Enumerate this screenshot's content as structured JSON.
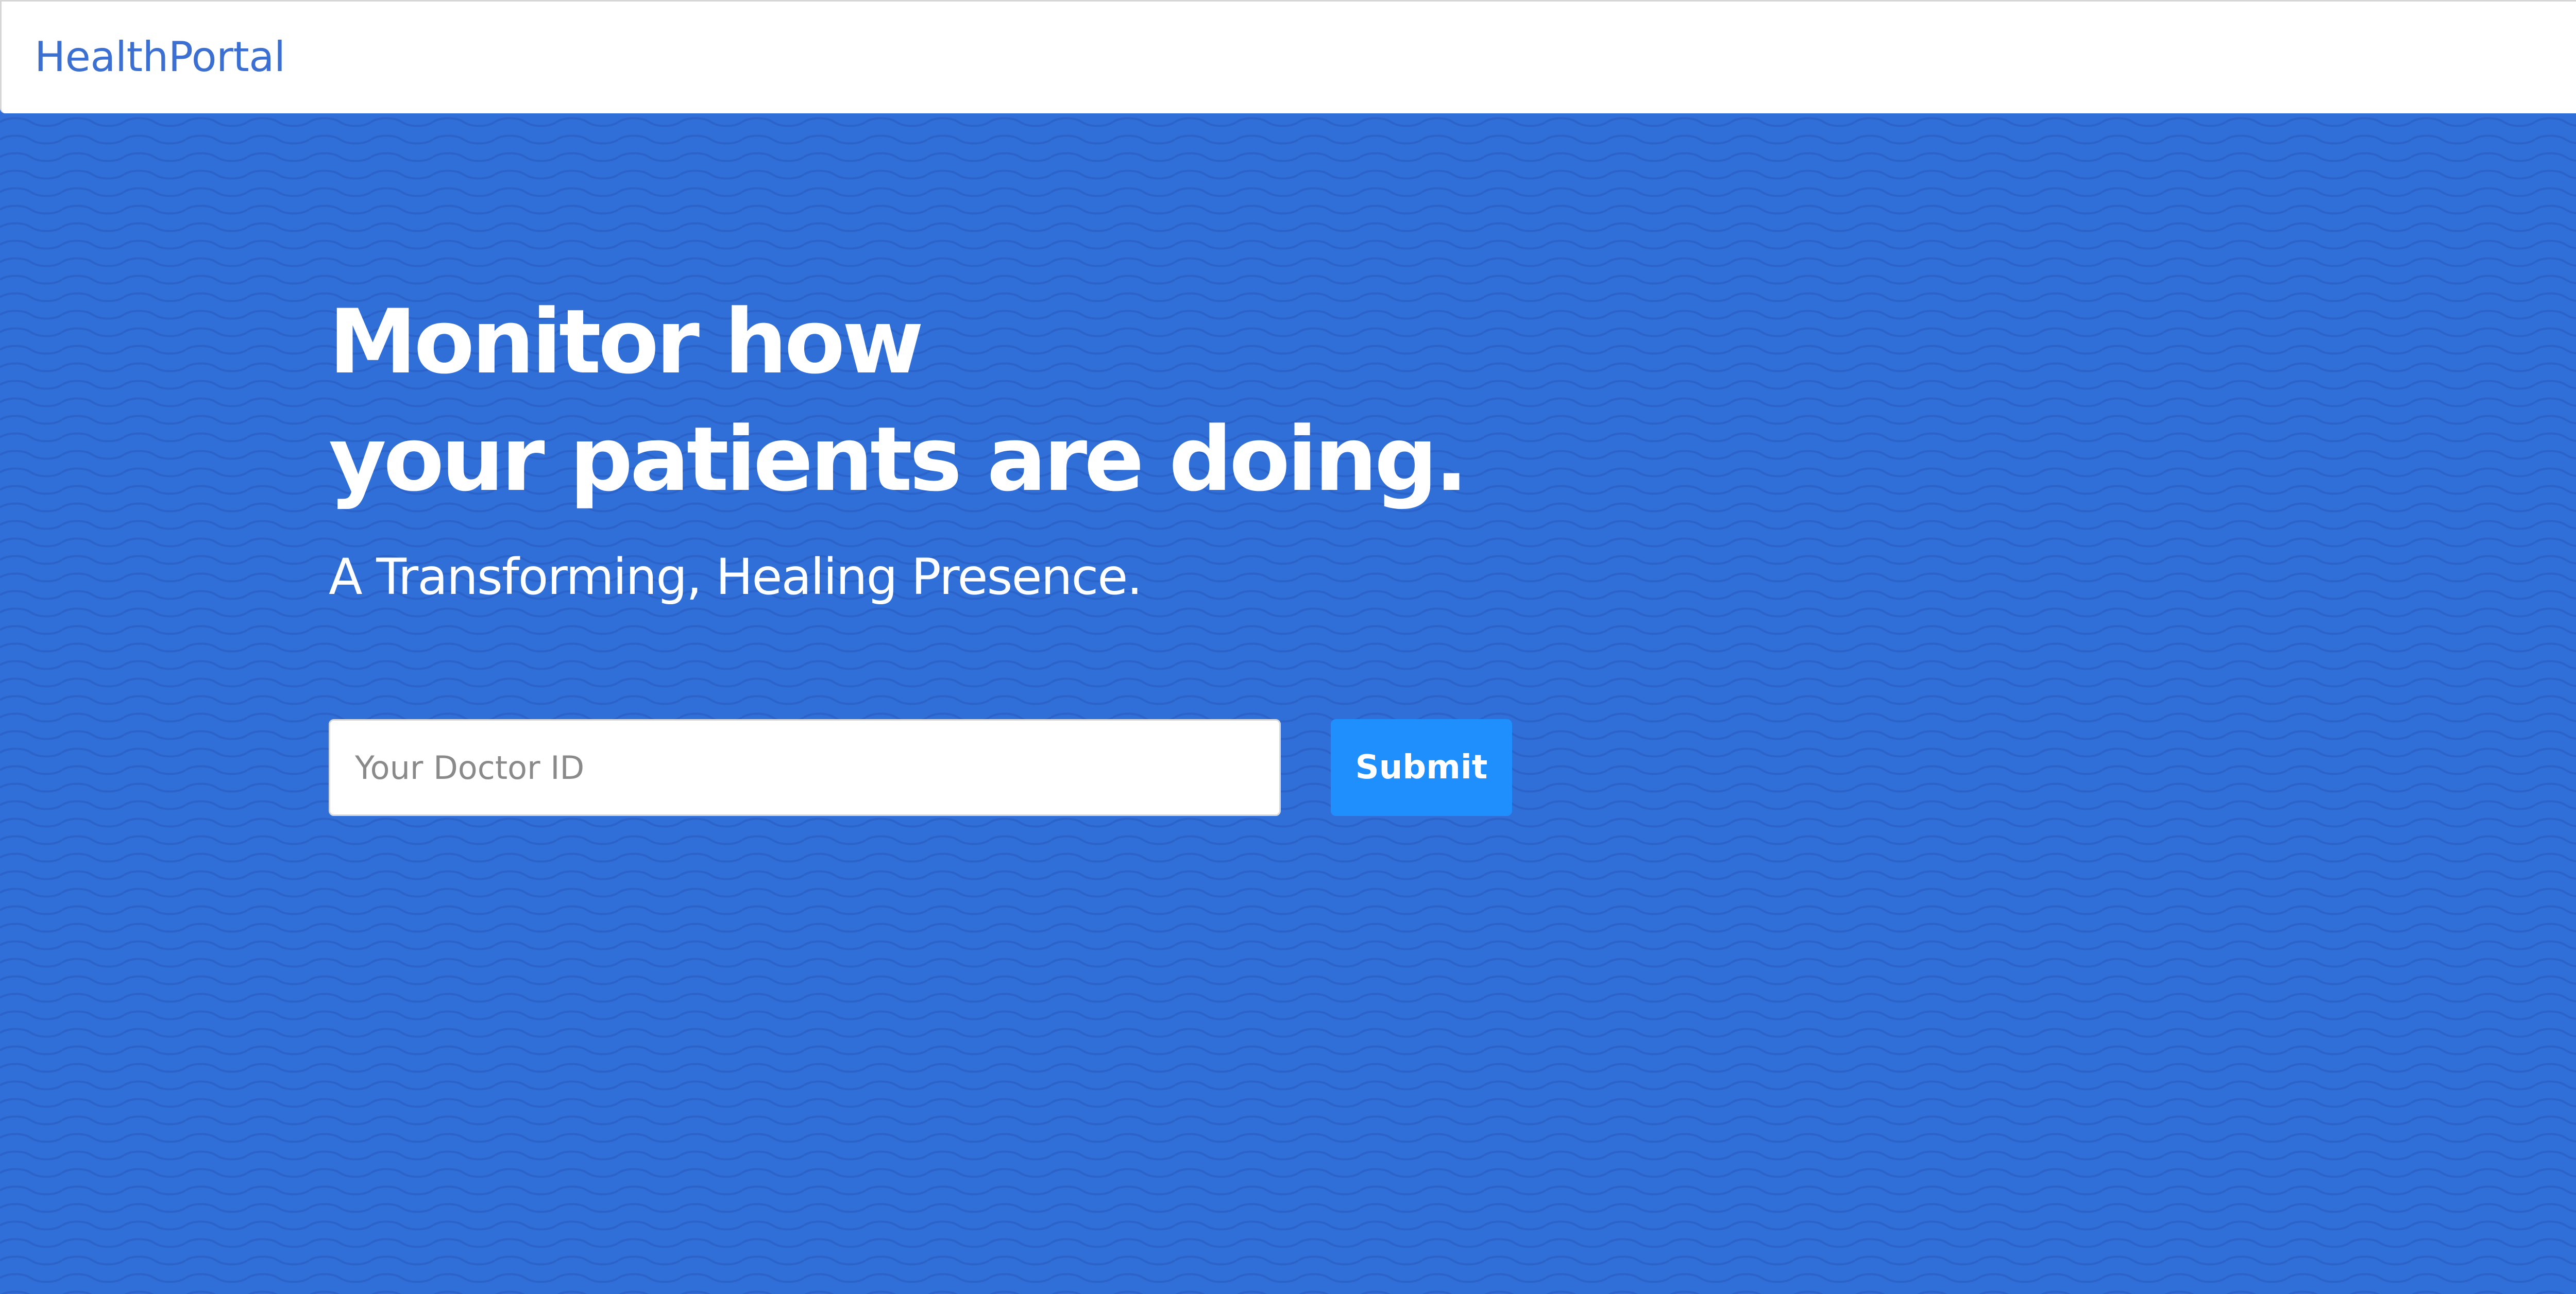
{
  "navbar": {
    "brand": "HealthPortal"
  },
  "hero": {
    "headline_line1": "Monitor how",
    "headline_line2": "your patients are doing.",
    "subtitle": "A Transforming, Healing Presence."
  },
  "form": {
    "doctor_id_placeholder": "Your Doctor ID",
    "doctor_id_value": "",
    "submit_label": "Submit"
  },
  "colors": {
    "brand_text": "#3b6fd1",
    "hero_background": "#2f6fd7",
    "submit_button": "#1e8ffd",
    "navbar_background": "#ffffff"
  }
}
